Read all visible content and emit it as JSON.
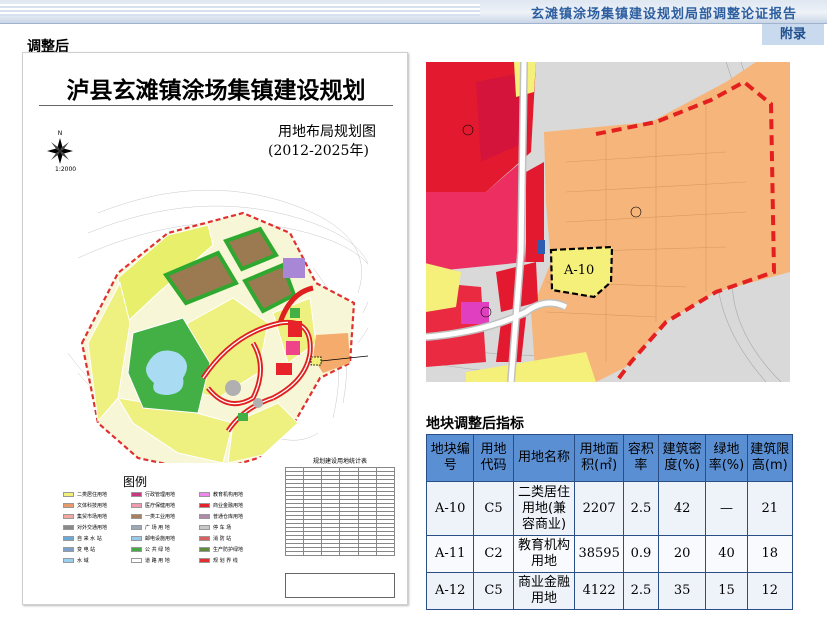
{
  "header": {
    "report_title": "玄滩镇涂场集镇建设规划局部调整论证报告",
    "appendix_tab": "附录"
  },
  "section_label": "调整后",
  "plan": {
    "title": "泸县玄滩镇涂场集镇建设规划",
    "subtitle": "用地布局规划图",
    "years": "(2012-2025年)",
    "north": "N",
    "scale": "1:2000",
    "legend_title": "图例",
    "stats_title": "规划建设用地统计表",
    "legend": [
      {
        "label": "二类居住用地",
        "color": "#f2f07a"
      },
      {
        "label": "行政管理用地",
        "color": "#c9377f"
      },
      {
        "label": "教育机构用地",
        "color": "#ee88ee"
      },
      {
        "label": "文体科技用地",
        "color": "#e89a6a"
      },
      {
        "label": "医疗保健用地",
        "color": "#f09bb0"
      },
      {
        "label": "商业金融用地",
        "color": "#e8222b"
      },
      {
        "label": "集贸市场用地",
        "color": "#f5a8a0"
      },
      {
        "label": "一类工业用地",
        "color": "#a88060"
      },
      {
        "label": "普通仓库用地",
        "color": "#b08aa8"
      },
      {
        "label": "对外交通用地",
        "color": "#8a8a8a"
      },
      {
        "label": "广 场 用 地",
        "color": "#9aa8b8"
      },
      {
        "label": "停 车 场",
        "color": "#c8c8c8"
      },
      {
        "label": "自 来 水 站",
        "color": "#6aa8d8"
      },
      {
        "label": "邮电设施用地",
        "color": "#9ac8e8"
      },
      {
        "label": "消 防 站",
        "color": "#d86060"
      },
      {
        "label": "变 电 站",
        "color": "#7aa0d0"
      },
      {
        "label": "公 共 绿 地",
        "color": "#44aa44"
      },
      {
        "label": "生产防护绿地",
        "color": "#5c8c3c"
      },
      {
        "label": "水 域",
        "color": "#98d0f0"
      },
      {
        "label": "道 路 用 地",
        "color": "#ffffff"
      },
      {
        "label": "规 划 界 线",
        "color": "#e03030"
      }
    ]
  },
  "zoom_map": {
    "parcel_label": "A-10"
  },
  "indicators": {
    "title": "地块调整后指标",
    "headers": [
      "地块编号",
      "用地代码",
      "用地名称",
      "用地面积(㎡)",
      "容积率",
      "建筑密度(%)",
      "绿地率(%)",
      "建筑限高(m)"
    ],
    "rows": [
      [
        "A-10",
        "C5",
        "二类居住用地(兼容商业)",
        "2207",
        "2.5",
        "42",
        "—",
        "21"
      ],
      [
        "A-11",
        "C2",
        "教育机构用地",
        "38595",
        "0.9",
        "20",
        "40",
        "18"
      ],
      [
        "A-12",
        "C5",
        "商业金融用地",
        "4122",
        "2.5",
        "35",
        "15",
        "12"
      ]
    ]
  }
}
